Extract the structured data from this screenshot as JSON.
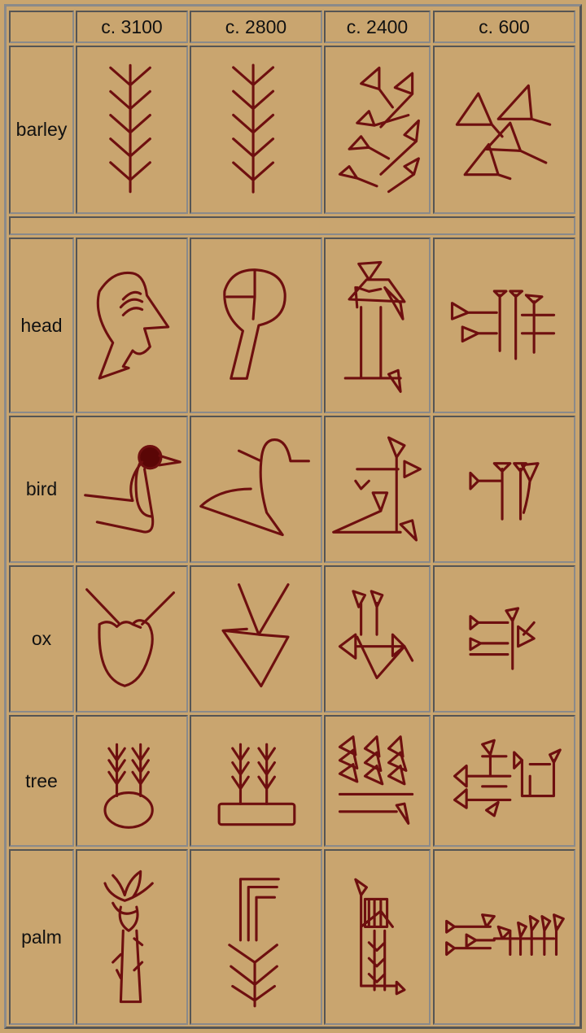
{
  "table": {
    "headers": [
      "",
      "c. 3100",
      "c. 2800",
      "c. 2400",
      "c. 600"
    ],
    "rows": [
      {
        "label": "barley"
      },
      {
        "label": "head"
      },
      {
        "label": "bird"
      },
      {
        "label": "ox"
      },
      {
        "label": "tree"
      },
      {
        "label": "palm"
      }
    ]
  },
  "colors": {
    "background": "#c9a56f",
    "glyph": "#6e0f0f"
  }
}
